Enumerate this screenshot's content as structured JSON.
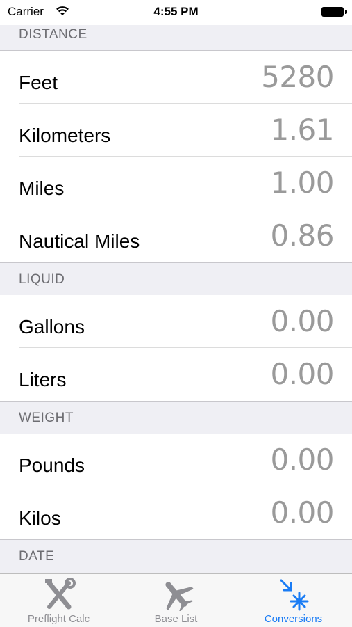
{
  "status_bar": {
    "carrier": "Carrier",
    "time": "4:55 PM"
  },
  "sections": {
    "distance": {
      "title": "DISTANCE",
      "rows": [
        {
          "label": "Feet",
          "value": "5280"
        },
        {
          "label": "Kilometers",
          "value": "1.61"
        },
        {
          "label": "Miles",
          "value": "1.00"
        },
        {
          "label": "Nautical Miles",
          "value": "0.86"
        }
      ]
    },
    "liquid": {
      "title": "LIQUID",
      "rows": [
        {
          "label": "Gallons",
          "value": "0.00"
        },
        {
          "label": "Liters",
          "value": "0.00"
        }
      ]
    },
    "weight": {
      "title": "WEIGHT",
      "rows": [
        {
          "label": "Pounds",
          "value": "0.00"
        },
        {
          "label": "Kilos",
          "value": "0.00"
        }
      ]
    },
    "date": {
      "title": "DATE"
    }
  },
  "tab_bar": {
    "tabs": [
      {
        "label": "Preflight Calc",
        "icon": "tools-icon"
      },
      {
        "label": "Base List",
        "icon": "airplane-icon"
      },
      {
        "label": "Conversions",
        "icon": "conversions-icon"
      }
    ],
    "active_index": 2,
    "active_color": "#1a7cf5",
    "inactive_color": "#8e8e93"
  }
}
